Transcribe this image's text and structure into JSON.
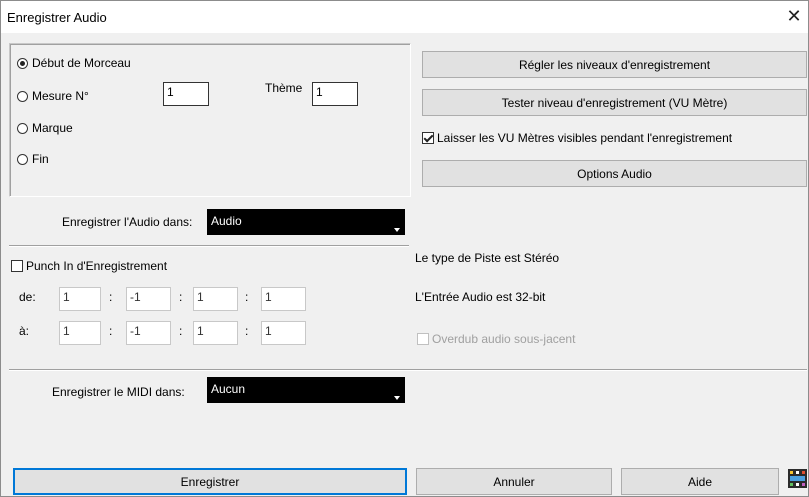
{
  "window": {
    "title": "Enregistrer Audio",
    "close_glyph": "✕"
  },
  "start": {
    "options": [
      {
        "label": "Début de Morceau",
        "selected": true
      },
      {
        "label": "Mesure N°",
        "selected": false
      },
      {
        "label": "Marque",
        "selected": false
      },
      {
        "label": "Fin",
        "selected": false
      }
    ],
    "measure_value": "1",
    "theme_label": "Thème",
    "theme_value": "1"
  },
  "buttons": {
    "set_levels": "Régler les niveaux d'enregistrement",
    "test_level": "Tester niveau d'enregistrement (VU Mètre)",
    "keep_vu_label": "Laisser les VU Mètres visibles pendant l'enregistrement",
    "keep_vu_checked": true,
    "audio_options": "Options Audio",
    "record": "Enregistrer",
    "cancel": "Annuler",
    "help": "Aide"
  },
  "audio_target": {
    "label": "Enregistrer l'Audio dans:",
    "value": "Audio"
  },
  "punch": {
    "label": "Punch In d'Enregistrement",
    "checked": false,
    "from_label": "de:",
    "to_label": "à:",
    "from_values": [
      "1",
      "-1",
      "1",
      "1"
    ],
    "to_values": [
      "1",
      "-1",
      "1",
      "1"
    ],
    "separator": ":"
  },
  "info": {
    "track_type": "Le type de Piste est Stéréo",
    "audio_input": "L'Entrée Audio est 32-bit",
    "overdub_label": "Overdub audio sous-jacent",
    "overdub_checked": false
  },
  "midi_target": {
    "label": "Enregistrer le MIDI dans:",
    "value": "Aucun"
  },
  "icons": {
    "film": "film-clapper-icon"
  }
}
